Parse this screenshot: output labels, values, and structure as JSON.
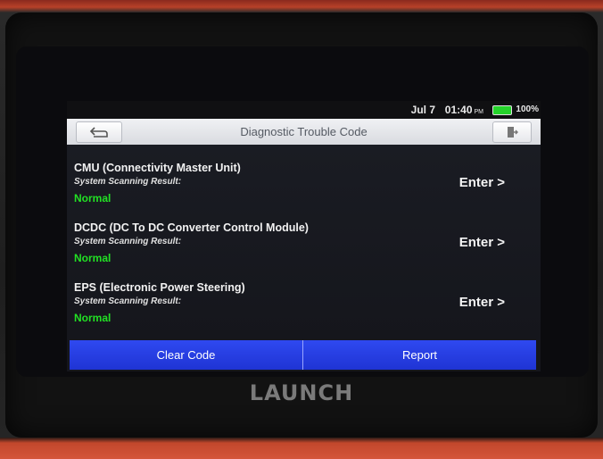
{
  "device": {
    "brand": "LAUNCH"
  },
  "status_bar": {
    "date": "Jul 7",
    "time": "01:40",
    "ampm": "PM",
    "battery": "100%"
  },
  "header": {
    "title": "Diagnostic Trouble Code",
    "back_icon": "back-arrow-icon",
    "exit_icon": "exit-icon"
  },
  "systems": [
    {
      "name": "CMU (Connectivity Master Unit)",
      "result_label": "System Scanning Result:",
      "status": "Normal",
      "enter_label": "Enter >"
    },
    {
      "name": "DCDC (DC To DC Converter Control Module)",
      "result_label": "System Scanning Result:",
      "status": "Normal",
      "enter_label": "Enter >"
    },
    {
      "name": "EPS (Electronic Power Steering)",
      "result_label": "System Scanning Result:",
      "status": "Normal",
      "enter_label": "Enter >"
    }
  ],
  "footer": {
    "clear_code_label": "Clear Code",
    "report_label": "Report"
  },
  "colors": {
    "status_normal": "#22e024",
    "button_blue": "#2f49f0",
    "battery_green": "#25d42b"
  }
}
